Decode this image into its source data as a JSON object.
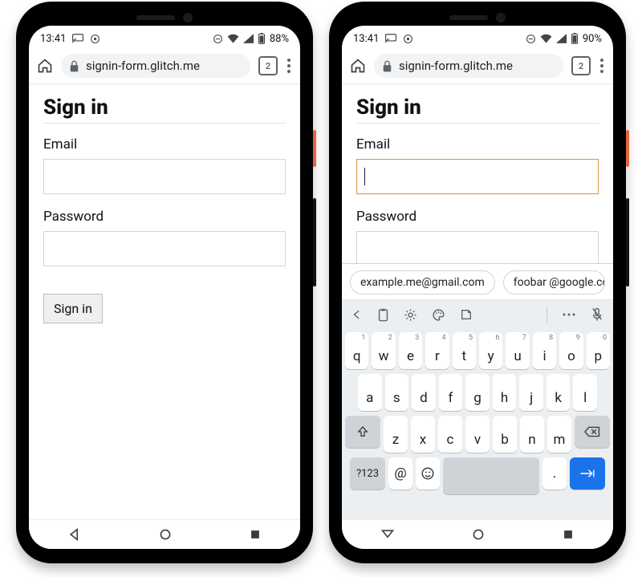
{
  "phones": {
    "left": {
      "status": {
        "time": "13:41",
        "battery": "88%"
      },
      "browser": {
        "url": "signin-form.glitch.me",
        "tab_count": "2"
      },
      "page": {
        "title": "Sign in",
        "email_label": "Email",
        "email_value": "",
        "password_label": "Password",
        "password_value": "",
        "submit_label": "Sign in"
      }
    },
    "right": {
      "status": {
        "time": "13:41",
        "battery": "90%"
      },
      "browser": {
        "url": "signin-form.glitch.me",
        "tab_count": "2"
      },
      "page": {
        "title": "Sign in",
        "email_label": "Email",
        "email_value": "",
        "password_label": "Password",
        "password_value": "",
        "submit_label": "Sign in"
      },
      "keyboard": {
        "suggestions": [
          "example.me@gmail.com",
          "foobar @google.co"
        ],
        "rows": {
          "r1": [
            {
              "k": "q",
              "s": "1"
            },
            {
              "k": "w",
              "s": "2"
            },
            {
              "k": "e",
              "s": "3"
            },
            {
              "k": "r",
              "s": "4"
            },
            {
              "k": "t",
              "s": "5"
            },
            {
              "k": "y",
              "s": "6"
            },
            {
              "k": "u",
              "s": "7"
            },
            {
              "k": "i",
              "s": "8"
            },
            {
              "k": "o",
              "s": "9"
            },
            {
              "k": "p",
              "s": "0"
            }
          ],
          "r2": [
            "a",
            "s",
            "d",
            "f",
            "g",
            "h",
            "j",
            "k",
            "l"
          ],
          "r3": [
            "z",
            "x",
            "c",
            "v",
            "b",
            "n",
            "m"
          ],
          "bottom": {
            "sym": "?123",
            "at": "@",
            "period": "."
          }
        }
      }
    }
  }
}
